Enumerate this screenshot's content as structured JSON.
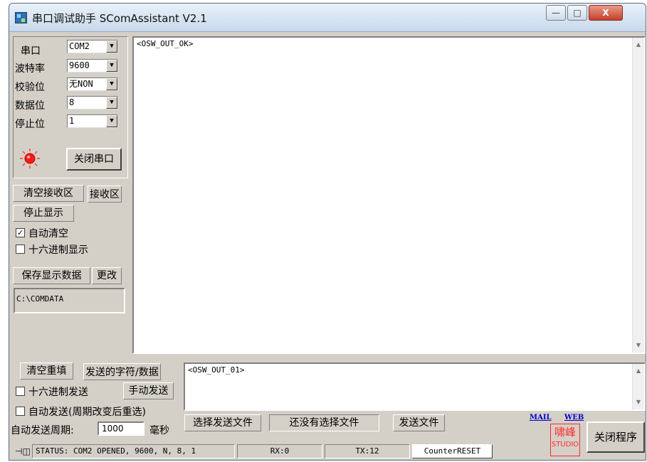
{
  "window": {
    "title": "串口调试助手 SComAssistant V2.1",
    "min": "—",
    "max": "□",
    "close": "X"
  },
  "port_settings": {
    "port_label": "串口",
    "port_value": "COM2",
    "baud_label": "波特率",
    "baud_value": "9600",
    "parity_label": "校验位",
    "parity_value": "无NON",
    "databits_label": "数据位",
    "databits_value": "8",
    "stopbits_label": "停止位",
    "stopbits_value": "1",
    "close_port_button": "关闭串口",
    "port_open": true
  },
  "receive": {
    "clear_button": "清空接收区",
    "receive_area_label": "接收区",
    "stop_display_button": "停止显示",
    "auto_clear_label": "自动清空",
    "auto_clear_checked": true,
    "hex_display_label": "十六进制显示",
    "hex_display_checked": false,
    "save_button": "保存显示数据",
    "change_button": "更改",
    "save_path": "C:\\COMDATA",
    "content": "<OSW_OUT_OK>"
  },
  "send": {
    "clear_resend_button": "清空重填",
    "send_data_label": "发送的字符/数据",
    "hex_send_label": "十六进制发送",
    "hex_send_checked": false,
    "manual_send_button": "手动发送",
    "auto_send_label": "自动发送(周期改变后重选)",
    "auto_send_checked": false,
    "period_label": "自动发送周期:",
    "period_value": "1000",
    "period_unit": "毫秒",
    "select_file_button": "选择发送文件",
    "file_status": "还没有选择文件",
    "send_file_button": "发送文件",
    "content": "<OSW_OUT_01>"
  },
  "footer": {
    "mail_link": "MAIL",
    "web_link": "WEB",
    "logo_text": "啸峰",
    "logo_sub": "STUDIO",
    "exit_button": "关闭程序"
  },
  "status": {
    "text": "STATUS: COM2 OPENED, 9600, N, 8, 1",
    "rx": "RX:0",
    "tx": "TX:12",
    "counter_reset": "CounterRESET"
  },
  "colors": {
    "indicator": "#ff1a1a",
    "logo": "#ff2a2a",
    "link": "#0000cc"
  }
}
